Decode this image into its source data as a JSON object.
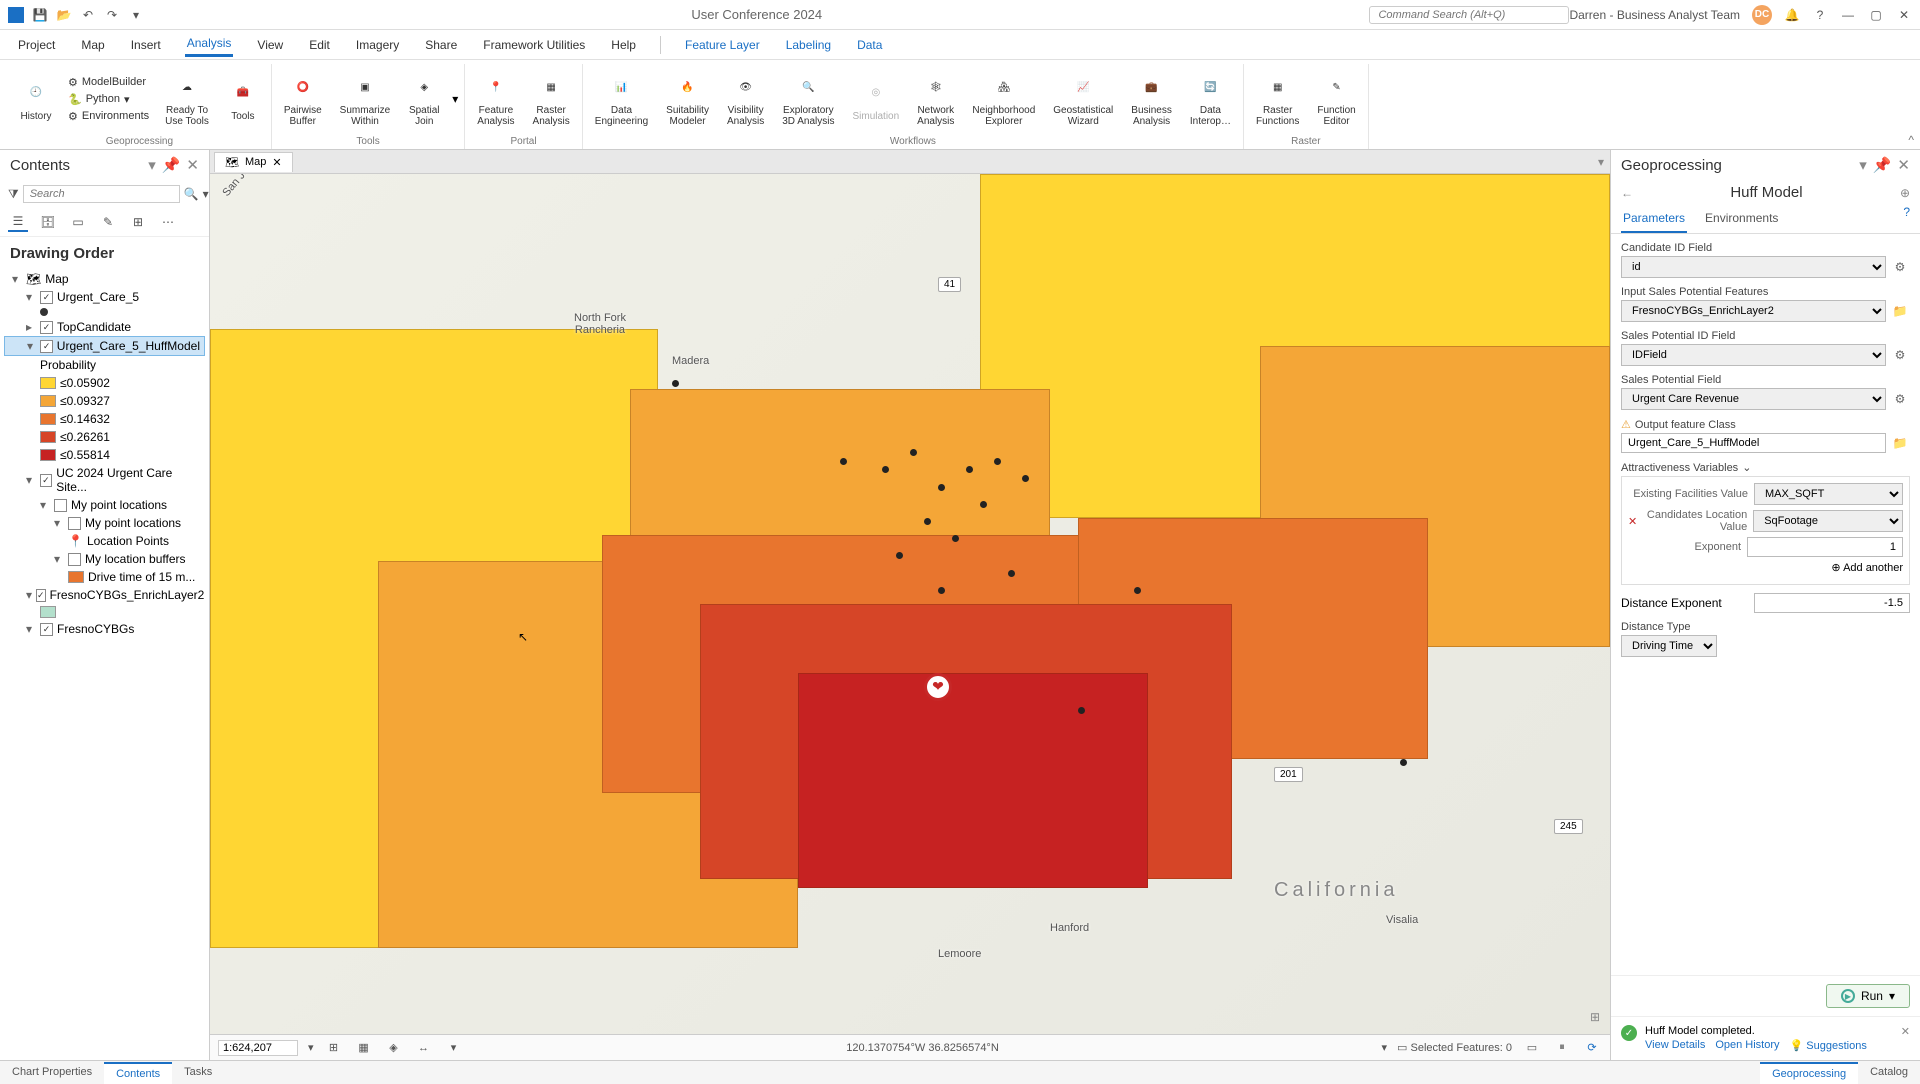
{
  "titlebar": {
    "center": "User Conference 2024",
    "search_placeholder": "Command Search (Alt+Q)",
    "user": "Darren - Business Analyst Team",
    "user_initials": "DC"
  },
  "menu": {
    "items": [
      "Project",
      "Map",
      "Insert",
      "Analysis",
      "View",
      "Edit",
      "Imagery",
      "Share",
      "Framework Utilities",
      "Help"
    ],
    "context_items": [
      "Feature Layer",
      "Labeling",
      "Data"
    ]
  },
  "ribbon": {
    "geoprocessing": {
      "label": "Geoprocessing",
      "history": "History",
      "modelbuilder": "ModelBuilder",
      "python": "Python",
      "environments": "Environments",
      "ready": "Ready To\nUse Tools",
      "tools": "Tools"
    },
    "tools": {
      "label": "Tools",
      "pairwise": "Pairwise\nBuffer",
      "summarize": "Summarize\nWithin",
      "spatial": "Spatial\nJoin"
    },
    "portal": {
      "label": "Portal",
      "feature": "Feature\nAnalysis",
      "raster": "Raster\nAnalysis"
    },
    "workflows": {
      "label": "Workflows",
      "data_eng": "Data\nEngineering",
      "suitability": "Suitability\nModeler",
      "visibility": "Visibility\nAnalysis",
      "exploratory": "Exploratory\n3D Analysis",
      "simulation": "Simulation",
      "network": "Network\nAnalysis",
      "neighborhood": "Neighborhood\nExplorer",
      "geostat": "Geostatistical\nWizard",
      "business": "Business\nAnalysis",
      "interop": "Data\nInterop…"
    },
    "raster": {
      "label": "Raster",
      "functions": "Raster\nFunctions",
      "editor": "Function\nEditor"
    }
  },
  "contents": {
    "title": "Contents",
    "search_placeholder": "Search",
    "section": "Drawing Order",
    "map_node": "Map",
    "layers": {
      "urgent_care_5": "Urgent_Care_5",
      "top_candidate": "TopCandidate",
      "huff_model": "Urgent_Care_5_HuffModel",
      "probability": "Probability",
      "classes": [
        {
          "color": "#ffd633",
          "label": "≤0.05902"
        },
        {
          "color": "#f4a637",
          "label": "≤0.09327"
        },
        {
          "color": "#e8752e",
          "label": "≤0.14632"
        },
        {
          "color": "#d64527",
          "label": "≤0.26261"
        },
        {
          "color": "#c62222",
          "label": "≤0.55814"
        }
      ],
      "uc_sites": "UC 2024 Urgent Care Site...",
      "my_point_loc": "My point locations",
      "my_point_loc_sub": "My point locations",
      "location_points": "Location Points",
      "my_buffers": "My location buffers",
      "drive_time": "Drive time of 15 m...",
      "enrich_layer": "FresnoCYBGs_EnrichLayer2",
      "cybgs": "FresnoCYBGs"
    }
  },
  "map": {
    "tab_name": "Map",
    "labels": {
      "san_joaquin": "San Joaquin Valley",
      "north_fork": "North Fork\nRancheria",
      "madera": "Madera",
      "california": "California",
      "visalia": "Visalia",
      "hanford": "Hanford",
      "lemoore": "Lemoore"
    },
    "routes": {
      "r41": "41",
      "r201": "201",
      "r245": "245"
    },
    "scale": "1:624,207",
    "coords": "120.1370754°W 36.8256574°N",
    "selected": "Selected Features: 0"
  },
  "gp": {
    "title": "Geoprocessing",
    "tool": "Huff Model",
    "tabs": {
      "params": "Parameters",
      "env": "Environments"
    },
    "params": {
      "cand_id_label": "Candidate ID Field",
      "cand_id_value": "id",
      "sales_feat_label": "Input Sales Potential Features",
      "sales_feat_value": "FresnoCYBGs_EnrichLayer2",
      "sales_id_label": "Sales Potential ID Field",
      "sales_id_value": "IDField",
      "sales_fld_label": "Sales Potential Field",
      "sales_fld_value": "Urgent Care Revenue",
      "output_label": "Output feature Class",
      "output_value": "Urgent_Care_5_HuffModel",
      "attr_label": "Attractiveness Variables",
      "existing_label": "Existing Facilities Value",
      "existing_value": "MAX_SQFT",
      "cand_loc_label": "Candidates Location Value",
      "cand_loc_value": "SqFootage",
      "exponent_label": "Exponent",
      "exponent_value": "1",
      "add_another": "Add another",
      "dist_exp_label": "Distance Exponent",
      "dist_exp_value": "-1.5",
      "dist_type_label": "Distance Type",
      "dist_type_value": "Driving Time"
    },
    "run": "Run",
    "msg": {
      "text": "Huff Model completed.",
      "details": "View Details",
      "history": "Open History",
      "suggestions": "Suggestions"
    }
  },
  "bottom_tabs": {
    "left": [
      "Chart Properties",
      "Contents",
      "Tasks"
    ],
    "right": [
      "Geoprocessing",
      "Catalog"
    ]
  }
}
